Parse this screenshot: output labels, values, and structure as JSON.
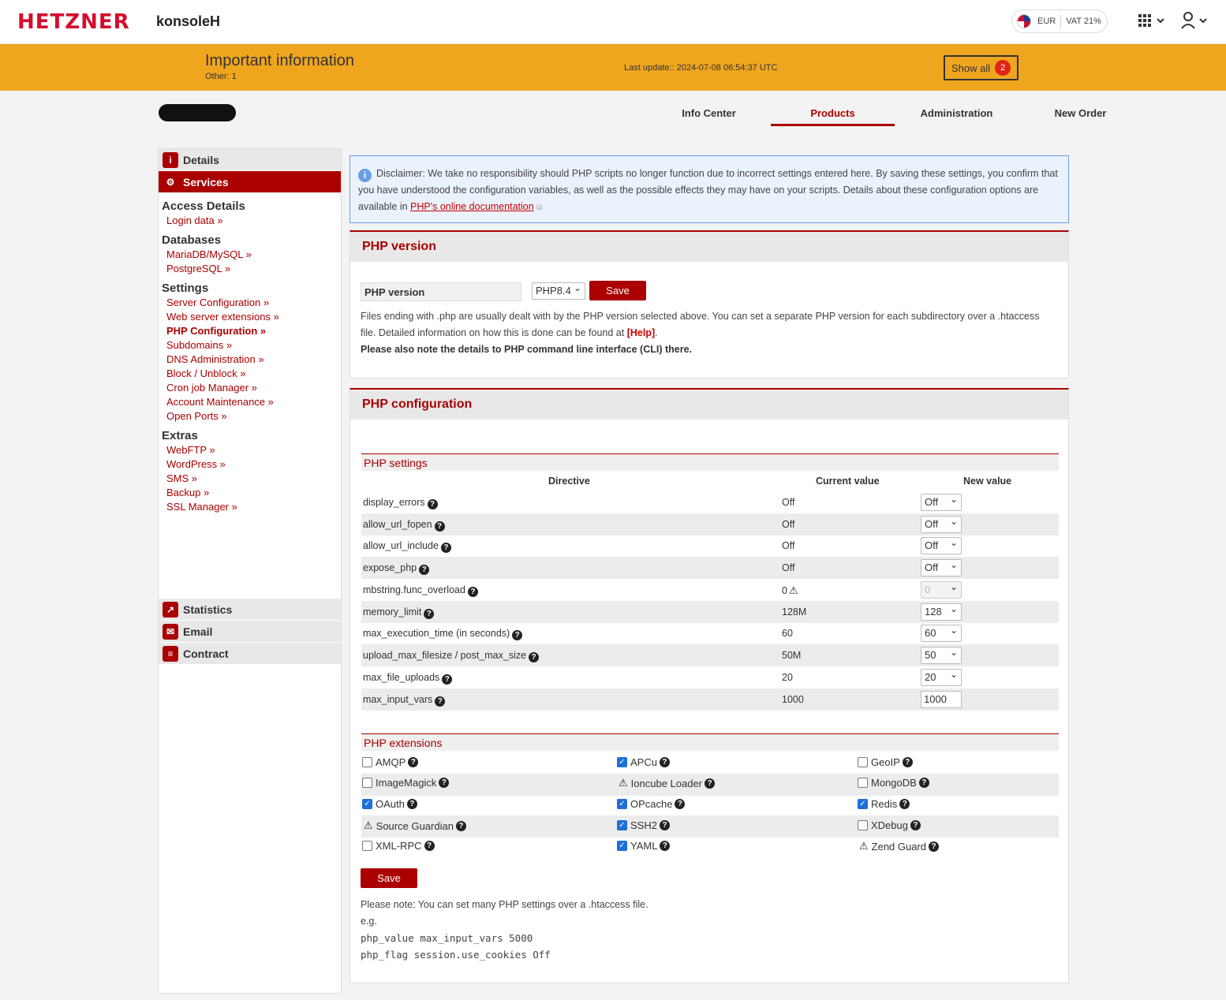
{
  "header": {
    "logo": "HETZNER",
    "product": "konsoleH",
    "currency": "EUR",
    "vat": "VAT 21%"
  },
  "banner": {
    "title": "Important information",
    "sub": "Other: 1",
    "last_update": "Last update:: 2024-07-08 06:54:37 UTC",
    "show_all": "Show all",
    "count": "2"
  },
  "nav": [
    "Info Center",
    "Products",
    "Administration",
    "New Order"
  ],
  "sidebar": {
    "details": "Details",
    "services": "Services",
    "access_details": "Access Details",
    "login_data": "Login data »",
    "databases": "Databases",
    "mariadb": "MariaDB/MySQL »",
    "postgres": "PostgreSQL »",
    "settings": "Settings",
    "settings_links": [
      "Server Configuration »",
      "Web server extensions »",
      "PHP Configuration »",
      "Subdomains »",
      "DNS Administration »",
      "Block / Unblock »",
      "Cron job Manager »",
      "Account Maintenance »",
      "Open Ports »"
    ],
    "extras": "Extras",
    "extras_links": [
      "WebFTP »",
      "WordPress »",
      "SMS »",
      "Backup »",
      "SSL Manager »"
    ],
    "statistics": "Statistics",
    "email": "Email",
    "contract": "Contract"
  },
  "disclaimer": {
    "text": "Disclaimer: We take no responsibility should PHP scripts no longer function due to incorrect settings entered here. By saving these settings, you confirm that you have understood the configuration variables, as well as the possible effects they may have on your scripts. Details about these configuration options are available in",
    "link": "PHP's online documentation"
  },
  "php_version": {
    "heading": "PHP version",
    "label": "PHP version",
    "selected": "PHP8.4",
    "save": "Save",
    "info1": "Files ending with .php are usually dealt with by the PHP version selected above. You can set a separate PHP version for each subdirectory over a .htaccess file. Detailed information on how this is done can be found at",
    "help": "[Help]",
    "info2": "Please also note the details to PHP command line interface (CLI) there."
  },
  "php_config": {
    "heading": "PHP configuration",
    "settings_heading": "PHP settings",
    "col_directive": "Directive",
    "col_current": "Current value",
    "col_new": "New value",
    "rows": [
      {
        "directive": "display_errors",
        "current": "Off",
        "new": "Off"
      },
      {
        "directive": "allow_url_fopen",
        "current": "Off",
        "new": "Off"
      },
      {
        "directive": "allow_url_include",
        "current": "Off",
        "new": "Off"
      },
      {
        "directive": "expose_php",
        "current": "Off",
        "new": "Off"
      },
      {
        "directive": "mbstring.func_overload",
        "current": "0",
        "new": "0"
      },
      {
        "directive": "memory_limit",
        "current": "128M",
        "new": "128"
      },
      {
        "directive": "max_execution_time (in seconds)",
        "current": "60",
        "new": "60"
      },
      {
        "directive": "upload_max_filesize / post_max_size",
        "current": "50M",
        "new": "50"
      },
      {
        "directive": "max_file_uploads",
        "current": "20",
        "new": "20"
      },
      {
        "directive": "max_input_vars",
        "current": "1000",
        "new": "1000"
      }
    ],
    "extensions_heading": "PHP extensions",
    "extensions": [
      {
        "name": "AMQP",
        "state": "off"
      },
      {
        "name": "APCu",
        "state": "on"
      },
      {
        "name": "GeoIP",
        "state": "off"
      },
      {
        "name": "ImageMagick",
        "state": "off"
      },
      {
        "name": "Ioncube Loader",
        "state": "warn"
      },
      {
        "name": "MongoDB",
        "state": "off"
      },
      {
        "name": "OAuth",
        "state": "on"
      },
      {
        "name": "OPcache",
        "state": "on"
      },
      {
        "name": "Redis",
        "state": "on"
      },
      {
        "name": "Source Guardian",
        "state": "warn"
      },
      {
        "name": "SSH2",
        "state": "on"
      },
      {
        "name": "XDebug",
        "state": "off"
      },
      {
        "name": "XML-RPC",
        "state": "off"
      },
      {
        "name": "YAML",
        "state": "on"
      },
      {
        "name": "Zend Guard",
        "state": "warn"
      }
    ],
    "save": "Save",
    "note": "Please note: You can set many PHP settings over a .htaccess file.",
    "eg": "e.g.",
    "code1": "php_value max_input_vars 5000",
    "code2": "php_flag session.use_cookies Off"
  }
}
